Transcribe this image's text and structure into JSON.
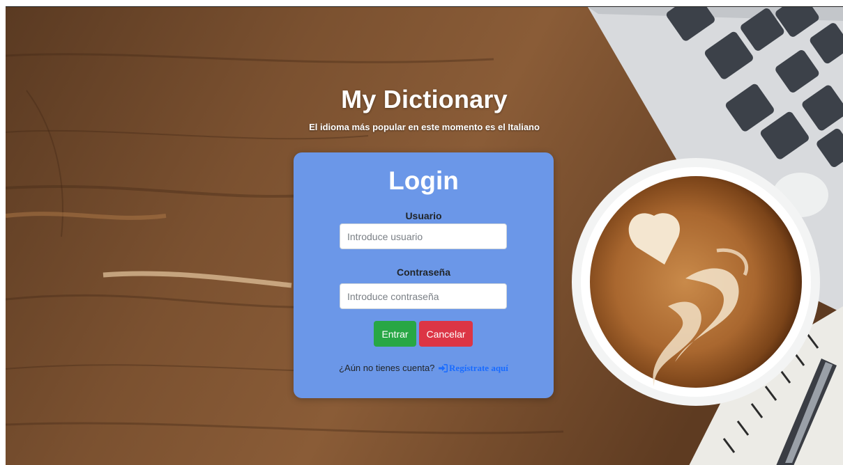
{
  "header": {
    "title": "My Dictionary",
    "subtitle": "El idioma más popular en este momento es el Italiano"
  },
  "login": {
    "title": "Login",
    "user_label": "Usuario",
    "user_placeholder": "Introduce usuario",
    "password_label": "Contraseña",
    "password_placeholder": "Introduce contraseña",
    "enter_button": "Entrar",
    "cancel_button": "Cancelar",
    "no_account_text": "¿Aún no tienes cuenta?",
    "register_link": "Regístrate aquí",
    "register_icon": "sign-in-icon"
  },
  "colors": {
    "card": "#6b97e8",
    "enter": "#28a745",
    "cancel": "#dc3545",
    "link": "#1a6cff"
  }
}
